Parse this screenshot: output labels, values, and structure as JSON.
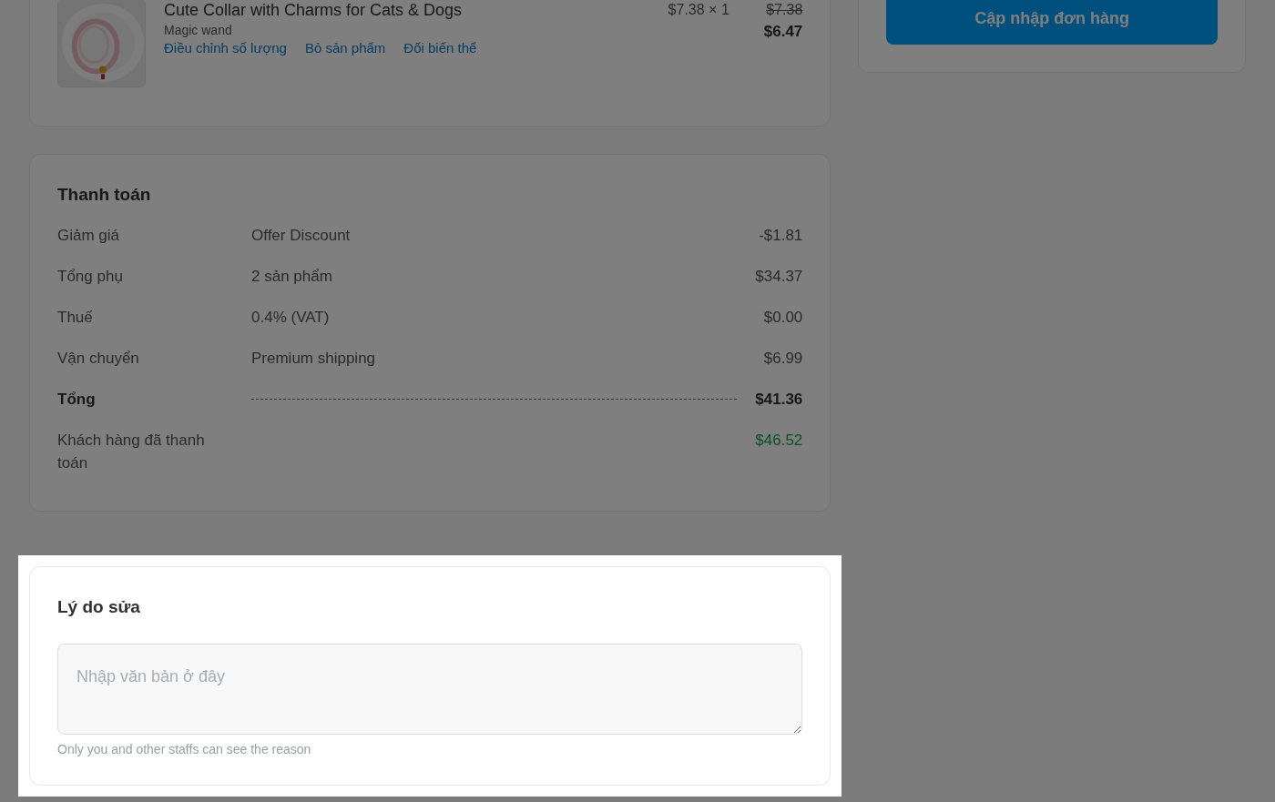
{
  "order_item": {
    "title": "Cute Collar with Charms for Cats & Dogs",
    "variant": "Magic wand",
    "actions": [
      "Điều chỉnh số lượng",
      "Bỏ sản phẩm",
      "Đổi biến thể"
    ],
    "unit_price": "$7.38 × 1",
    "original_price": "$7.38",
    "price": "$6.47"
  },
  "update_button": {
    "label": "Cập nhập đơn hàng"
  },
  "payment": {
    "title": "Thanh toán",
    "rows": [
      {
        "kind": "normal",
        "label": "Giảm giá",
        "detail": "Offer Discount",
        "amount": "-$1.81"
      },
      {
        "kind": "normal",
        "label": "Tổng phụ",
        "detail": "2 sản phẩm",
        "amount": "$34.37"
      },
      {
        "kind": "normal",
        "label": "Thuế",
        "detail": "0.4% (VAT)",
        "amount": "$0.00"
      },
      {
        "kind": "normal",
        "label": "Vận chuyển",
        "detail": "Premium shipping",
        "amount": "$6.99"
      },
      {
        "kind": "total",
        "label": "Tổng",
        "amount": "$41.36"
      },
      {
        "kind": "paid",
        "label": "Khách hàng đã thanh toán",
        "amount": "$46.52"
      }
    ]
  },
  "reason": {
    "title": "Lý do sửa",
    "placeholder": "Nhập văn bản ở đây",
    "note": "Only you and other staffs can see the reason"
  }
}
